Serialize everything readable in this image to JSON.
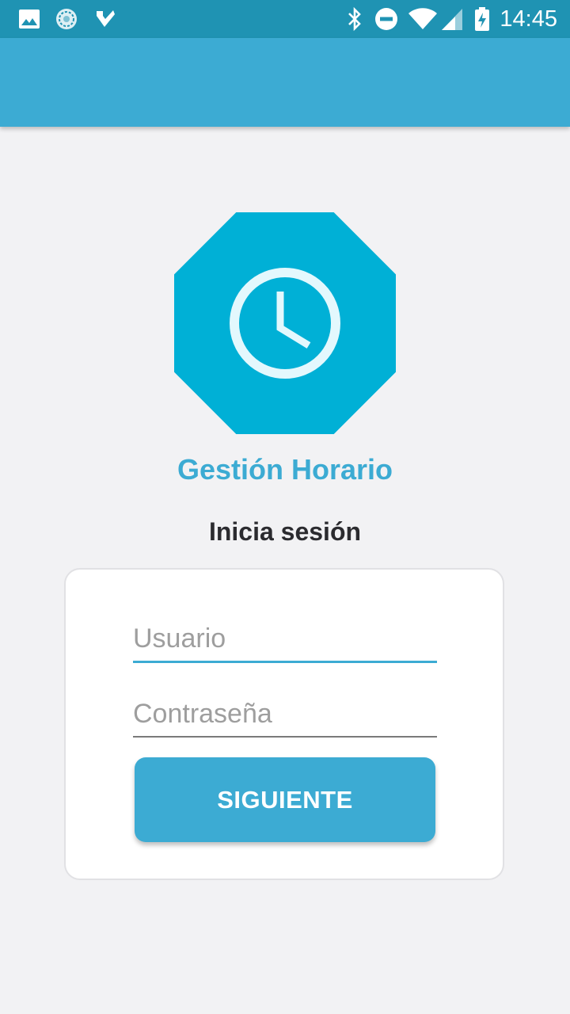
{
  "status_bar": {
    "time": "14:45",
    "icons": [
      "image-icon",
      "sync-icon",
      "check-icon",
      "bluetooth-icon",
      "do-not-disturb-icon",
      "wifi-icon",
      "signal-icon",
      "battery-charging-icon"
    ]
  },
  "app_bar": {
    "color": "#3cabd3"
  },
  "logo": {
    "icon": "clock-icon",
    "color": "#00b0d6"
  },
  "app_title": "Gestión Horario",
  "login_heading": "Inicia sesión",
  "form": {
    "username": {
      "placeholder": "Usuario",
      "value": ""
    },
    "password": {
      "placeholder": "Contraseña",
      "value": ""
    },
    "submit_label": "SIGUIENTE"
  }
}
